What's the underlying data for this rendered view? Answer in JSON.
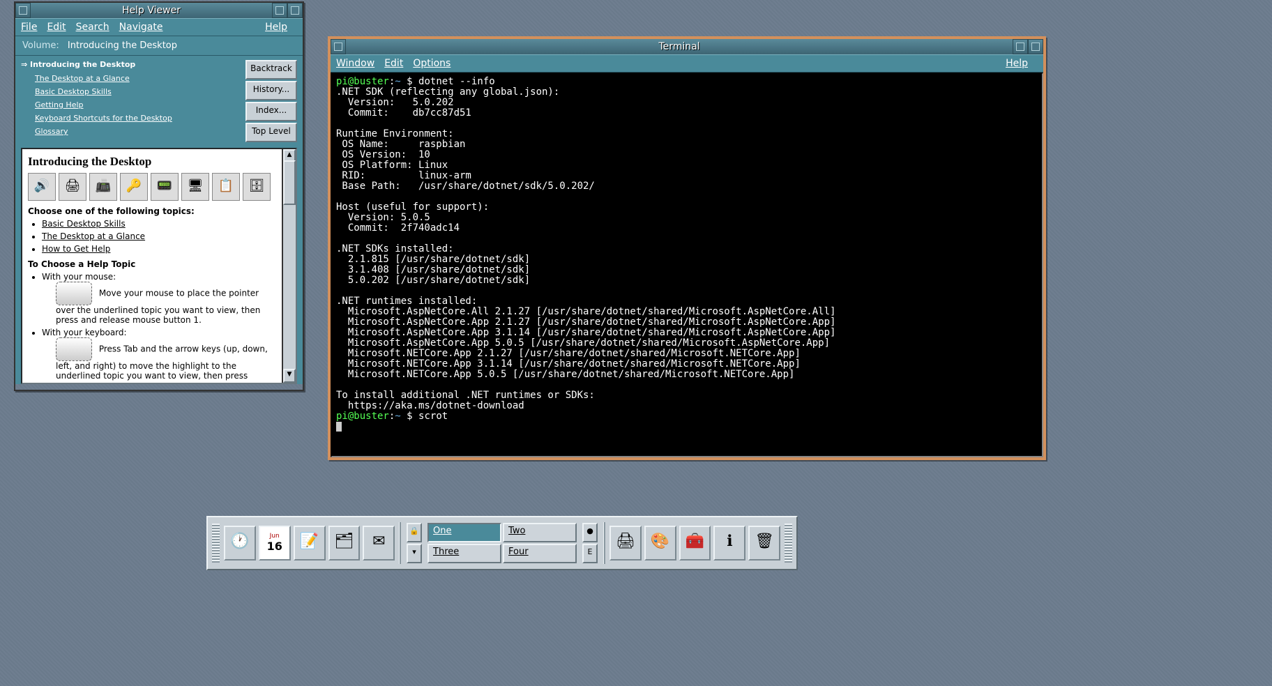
{
  "helpviewer": {
    "title": "Help Viewer",
    "menus": [
      "File",
      "Edit",
      "Search",
      "Navigate"
    ],
    "help_menu": "Help",
    "volume_label": "Volume:",
    "volume_value": "Introducing the Desktop",
    "nav_heading": "Introducing the Desktop",
    "nav_items": [
      "The Desktop at a Glance",
      "Basic Desktop Skills",
      "Getting Help",
      "Keyboard Shortcuts for the Desktop",
      "Glossary"
    ],
    "buttons": [
      "Backtrack",
      "History...",
      "Index...",
      "Top Level"
    ],
    "content_title": "Introducing the Desktop",
    "choose_label": "Choose one of the following topics:",
    "topic_links": [
      "Basic Desktop Skills",
      "The Desktop at a Glance",
      "How to Get Help"
    ],
    "choose_help_label": "To Choose a Help Topic",
    "mouse_heading": "With your mouse:",
    "mouse_text": "Move your mouse to place the pointer over the underlined topic you want to view, then press and release mouse button 1.",
    "kbd_heading": "With your keyboard:",
    "kbd_text": "Press Tab and the arrow keys (up, down, left, and right) to move the highlight to the underlined topic you want to view, then press"
  },
  "terminal": {
    "title": "Terminal",
    "menus": [
      "Window",
      "Edit",
      "Options"
    ],
    "help_menu": "Help",
    "prompt_user": "pi@buster",
    "prompt_path": "~",
    "prompt_sym": "$",
    "cmd1": "dotnet --info",
    "output": ".NET SDK (reflecting any global.json):\n  Version:   5.0.202\n  Commit:    db7cc87d51\n\nRuntime Environment:\n OS Name:     raspbian\n OS Version:  10\n OS Platform: Linux\n RID:         linux-arm\n Base Path:   /usr/share/dotnet/sdk/5.0.202/\n\nHost (useful for support):\n  Version: 5.0.5\n  Commit:  2f740adc14\n\n.NET SDKs installed:\n  2.1.815 [/usr/share/dotnet/sdk]\n  3.1.408 [/usr/share/dotnet/sdk]\n  5.0.202 [/usr/share/dotnet/sdk]\n\n.NET runtimes installed:\n  Microsoft.AspNetCore.All 2.1.27 [/usr/share/dotnet/shared/Microsoft.AspNetCore.All]\n  Microsoft.AspNetCore.App 2.1.27 [/usr/share/dotnet/shared/Microsoft.AspNetCore.App]\n  Microsoft.AspNetCore.App 3.1.14 [/usr/share/dotnet/shared/Microsoft.AspNetCore.App]\n  Microsoft.AspNetCore.App 5.0.5 [/usr/share/dotnet/shared/Microsoft.AspNetCore.App]\n  Microsoft.NETCore.App 2.1.27 [/usr/share/dotnet/shared/Microsoft.NETCore.App]\n  Microsoft.NETCore.App 3.1.14 [/usr/share/dotnet/shared/Microsoft.NETCore.App]\n  Microsoft.NETCore.App 5.0.5 [/usr/share/dotnet/shared/Microsoft.NETCore.App]\n\nTo install additional .NET runtimes or SDKs:\n  https://aka.ms/dotnet-download",
    "cmd2": "scrot"
  },
  "panel": {
    "cal_month": "Jun",
    "cal_day": "16",
    "pager": [
      {
        "label": "One",
        "active": true
      },
      {
        "label": "Two",
        "active": false
      },
      {
        "label": "Three",
        "active": false
      },
      {
        "label": "Four",
        "active": false
      }
    ]
  }
}
